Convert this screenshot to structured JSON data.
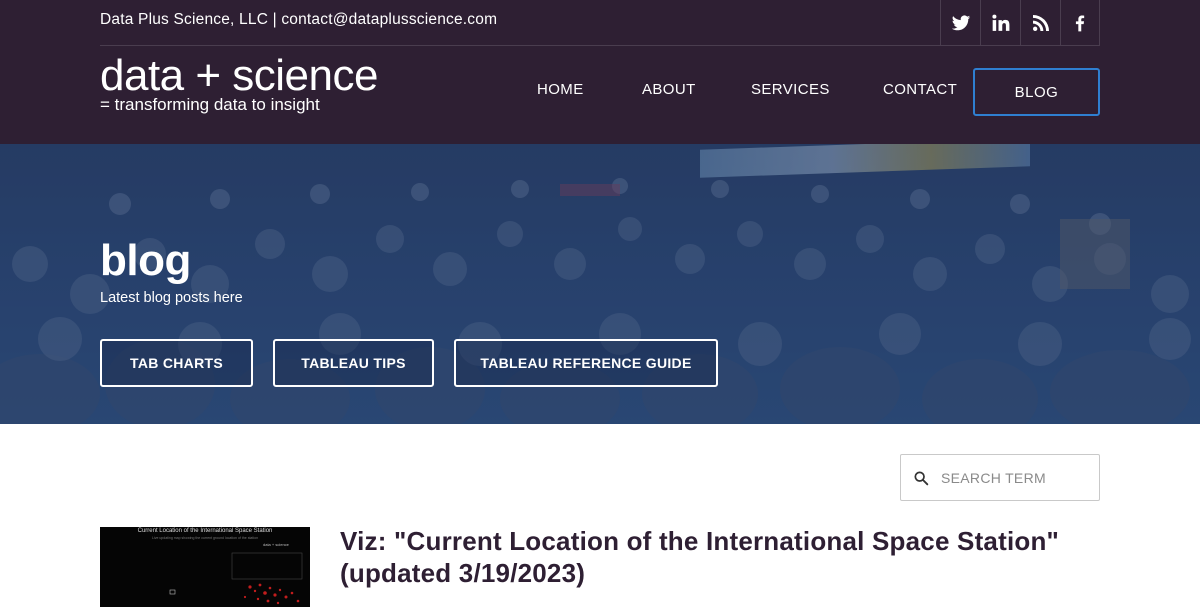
{
  "topbar": {
    "contact_text": "Data Plus Science, LLC | contact@dataplusscience.com",
    "social_icons": [
      "twitter-icon",
      "linkedin-icon",
      "rss-icon",
      "facebook-icon"
    ]
  },
  "logo": {
    "main": "data + science",
    "tagline": "= transforming data to insight"
  },
  "nav": {
    "items": [
      "HOME",
      "ABOUT",
      "SERVICES",
      "CONTACT"
    ],
    "blog_label": "BLOG"
  },
  "hero": {
    "title": "blog",
    "subtitle": "Latest blog posts here",
    "buttons": [
      "TAB CHARTS",
      "TABLEAU TIPS",
      "TABLEAU REFERENCE GUIDE"
    ]
  },
  "search": {
    "placeholder": "SEARCH TERM",
    "value": ""
  },
  "post": {
    "thumbnail_title": "Current Location of the International Space Station",
    "thumbnail_subtitle": "Live updating map showing the current ground location of the station",
    "thumbnail_brand": "data + science",
    "title": "Viz: \"Current Location of the International Space Station\" (updated 3/19/2023)"
  },
  "colors": {
    "header_bg": "#2e1f33",
    "blog_border": "#2f7fd1",
    "hero_tint": "#2d4670",
    "post_title": "#2e1f33"
  }
}
